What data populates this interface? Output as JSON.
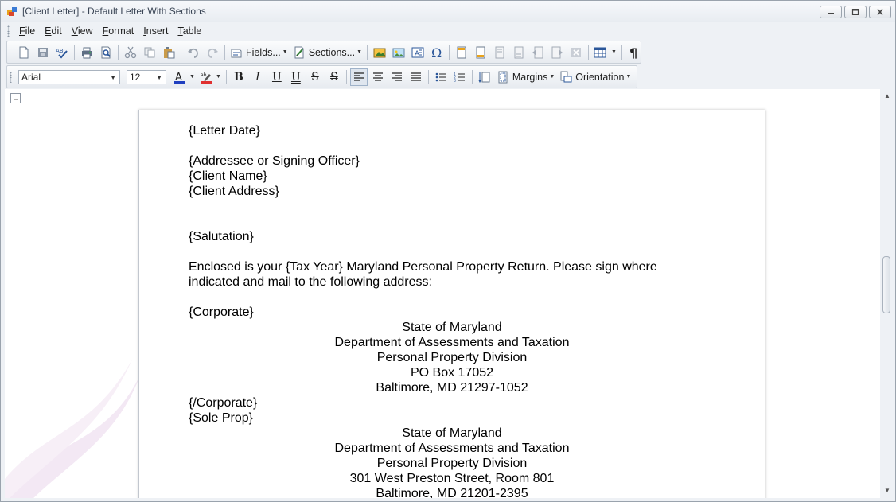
{
  "window": {
    "title": "[Client Letter] - Default Letter With Sections"
  },
  "menu": {
    "items": [
      {
        "key": "F",
        "rest": "ile"
      },
      {
        "key": "E",
        "rest": "dit"
      },
      {
        "key": "V",
        "rest": "iew"
      },
      {
        "key": "F",
        "rest": "ormat"
      },
      {
        "key": "I",
        "rest": "nsert"
      },
      {
        "key": "T",
        "rest": "able"
      }
    ]
  },
  "toolbar": {
    "fields_label": "Fields...",
    "sections_label": "Sections...",
    "font_name": "Arial",
    "font_size": "12",
    "margins_label": "Margins",
    "orientation_label": "Orientation"
  },
  "document": {
    "letter_date": "{Letter Date}",
    "addressee": "{Addressee or Signing Officer}",
    "client_name": "{Client Name}",
    "client_address": "{Client Address}",
    "salutation": "{Salutation}",
    "body_line1": "Enclosed is your {Tax Year} Maryland Personal Property Return. Please sign where",
    "body_line2": "indicated and mail to the following address:",
    "corporate_open": "{Corporate}",
    "corporate_address": [
      "State of Maryland",
      "Department of Assessments and Taxation",
      "Personal Property Division",
      "PO Box 17052",
      "Baltimore, MD 21297-1052"
    ],
    "corporate_close": "{/Corporate}",
    "soleprop_open": "{Sole Prop}",
    "soleprop_address": [
      "State of Maryland",
      "Department of Assessments and Taxation",
      "Personal Property Division",
      "301 West Preston Street, Room 801",
      "Baltimore, MD 21201-2395"
    ]
  },
  "colors": {
    "accent": "#2b579a",
    "font_color": "#1f3fbf",
    "highlight": "#e03030"
  }
}
